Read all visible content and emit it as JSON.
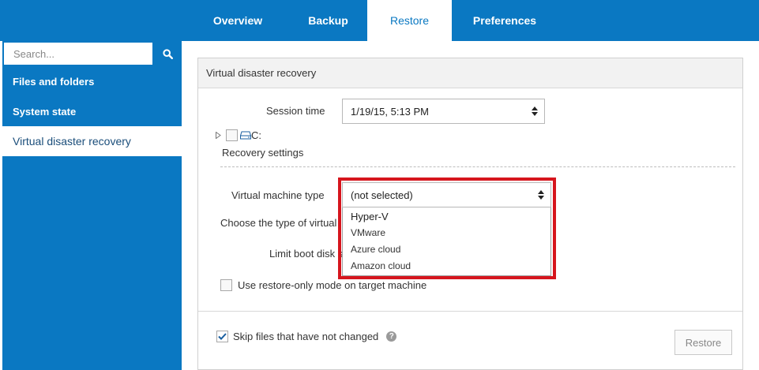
{
  "tabs": [
    {
      "label": "Overview"
    },
    {
      "label": "Backup"
    },
    {
      "label": "Restore"
    },
    {
      "label": "Preferences"
    }
  ],
  "sidebar": {
    "search_placeholder": "Search...",
    "items": [
      {
        "label": "Files and folders"
      },
      {
        "label": "System state"
      },
      {
        "label": "Virtual disaster recovery"
      }
    ]
  },
  "panel": {
    "title": "Virtual disaster recovery",
    "session_time_label": "Session time",
    "session_time_value": "1/19/15, 5:13 PM",
    "drive_label": "C:",
    "recovery_settings_label": "Recovery settings",
    "vm_type_label": "Virtual machine type",
    "vm_type_value": "(not selected)",
    "vm_type_options": [
      "Hyper-V",
      "VMware",
      "Azure cloud",
      "Amazon cloud"
    ],
    "choose_type_label": "Choose the type of virtual",
    "limit_boot_label": "Limit boot disk s",
    "restore_only_label": "Use restore-only mode on target machine",
    "skip_files_label": "Skip files that have not changed",
    "restore_button": "Restore"
  },
  "colors": {
    "brand_blue": "#0a78c2",
    "highlight_red": "#d6151d"
  }
}
